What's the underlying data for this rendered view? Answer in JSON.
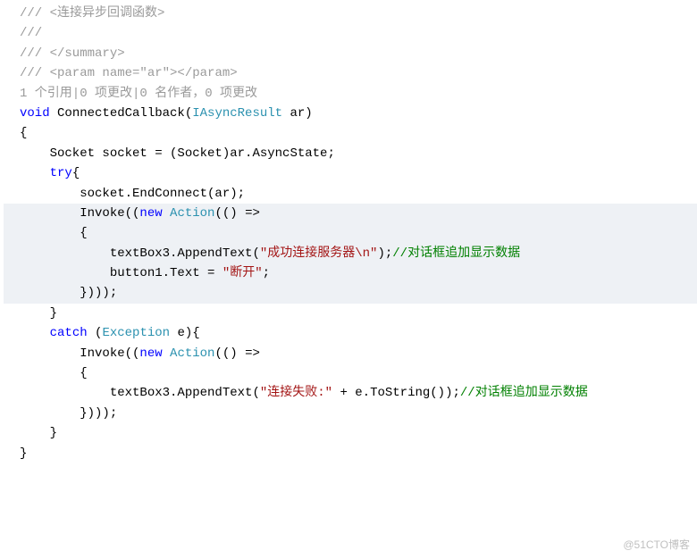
{
  "lines": {
    "c1": "/// <连接异步回调函数>",
    "c2": "///",
    "c3": "/// </summary>",
    "c4_pre": "/// <param name=",
    "c4_str": "\"ar\"",
    "c4_post": "></param>",
    "ann": "1 个引用|0 项更改|0 名作者，0 项更改",
    "sig_kw": "void",
    "sig_name": " ConnectedCallback(",
    "sig_type": "IAsyncResult",
    "sig_param": " ar)",
    "brace_open": "{",
    "l_socket": "    Socket socket = (Socket)ar.AsyncState;",
    "try_kw": "try",
    "try_post": "{",
    "l_endconnect": "        socket.EndConnect(ar);",
    "l_blank": "",
    "inv1_pre": "        Invoke((",
    "inv1_new": "new",
    "inv1_sp": " ",
    "inv1_action": "Action",
    "inv1_post": "(() =>",
    "inv1_brace": "        {",
    "inv1_tb_pre": "            textBox3.AppendText(",
    "inv1_tb_str": "\"成功连接服务器\\n\"",
    "inv1_tb_post": ");",
    "inv1_tb_cmt": "//对话框追加显示数据",
    "inv1_btn_pre": "            button1.Text = ",
    "inv1_btn_str": "\"断开\"",
    "inv1_btn_post": ";",
    "inv1_close": "        })));",
    "try_close": "    }",
    "catch_pre": "    ",
    "catch_kw": "catch",
    "catch_sp": " (",
    "catch_type": "Exception",
    "catch_post": " e){",
    "inv2_pre": "        Invoke((",
    "inv2_new": "new",
    "inv2_sp": " ",
    "inv2_action": "Action",
    "inv2_post": "(() =>",
    "inv2_brace": "        {",
    "inv2_tb_pre": "            textBox3.AppendText(",
    "inv2_tb_str": "\"连接失败:\"",
    "inv2_tb_post": " + e.ToString());",
    "inv2_tb_cmt": "//对话框追加显示数据",
    "inv2_close": "        })));",
    "catch_close": "    }",
    "brace_close": "}"
  },
  "watermark": "@51CTO博客"
}
